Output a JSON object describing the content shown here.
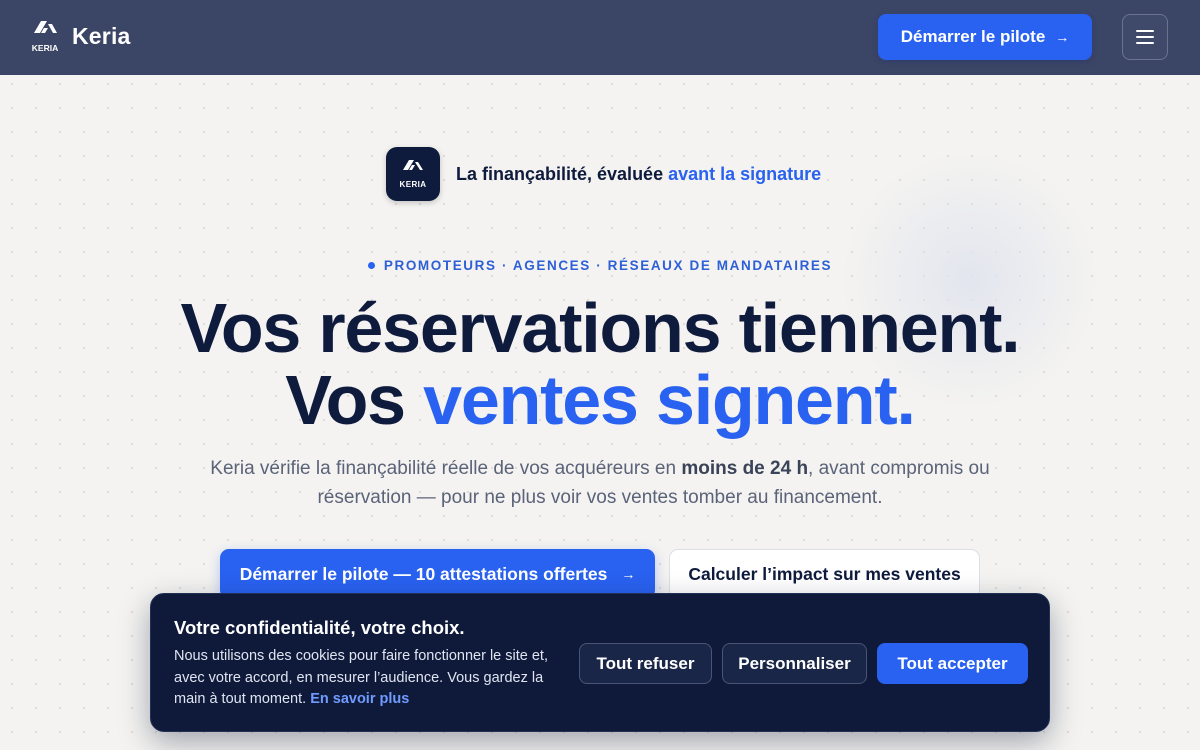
{
  "header": {
    "brand_name": "Keria",
    "brand_mark_text": "KERIA",
    "cta_label": "Démarrer le pilote",
    "cta_icon": "arrow-right-icon",
    "menu_icon": "hamburger-menu-icon"
  },
  "tagline": {
    "icon_text": "KERIA",
    "text": "La finançabilité, évaluée",
    "accent": "avant la signature"
  },
  "hero": {
    "eyebrow": "PROMOTEURS · AGENCES · RÉSEAUX DE MANDATAIRES",
    "headline_line1": "Vos réservations tiennent.",
    "headline_line2_prefix": "Vos",
    "headline_line2_accent": "ventes signent.",
    "subtitle_before": "Keria vérifie la finançabilité réelle de vos acquéreurs en",
    "subtitle_bold": "moins de 24 h",
    "subtitle_after": ", avant compromis ou réservation — pour ne plus voir vos ventes tomber au financement.",
    "cta_primary": "Démarrer le pilote — 10 attestations offertes",
    "cta_secondary": "Calculer l’impact sur mes ventes"
  },
  "cookie": {
    "title": "Votre confidentialité, votre choix.",
    "body": "Nous utilisons des cookies pour faire fonctionner le site et, avec votre accord, en mesurer l’audience. Vous gardez la main à tout moment.",
    "link": "En savoir plus",
    "refuse": "Tout refuser",
    "customize": "Personnaliser",
    "accept": "Tout accepter"
  },
  "colors": {
    "accent": "#2962f0",
    "navy": "#0f1b3d",
    "header_bg": "#3b4566",
    "page_bg": "#f4f3f1"
  }
}
